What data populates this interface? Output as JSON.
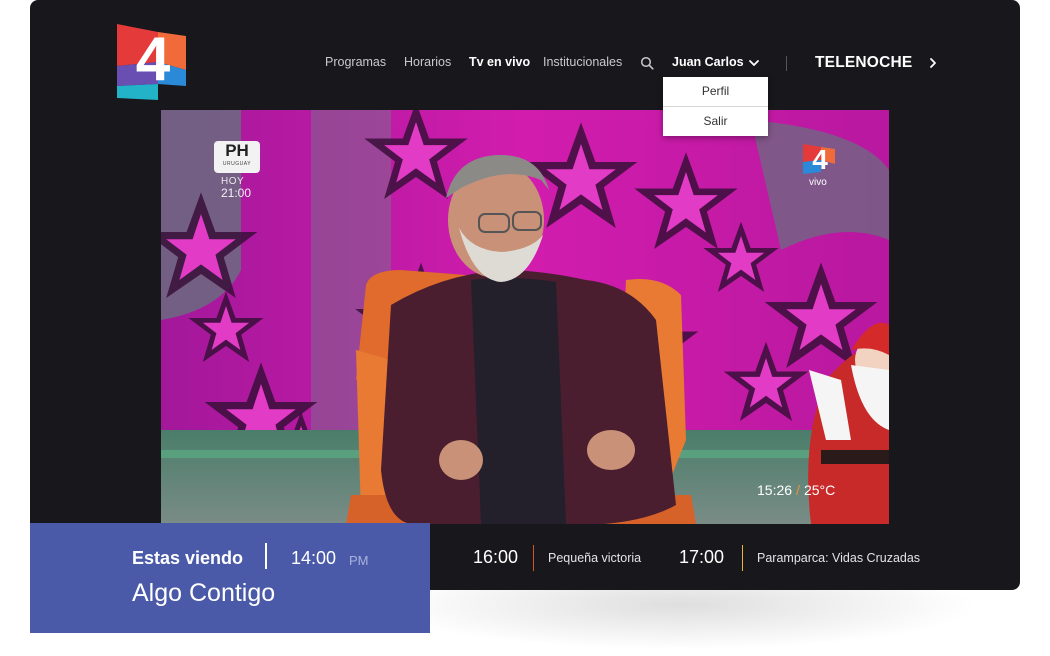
{
  "nav": {
    "items": [
      {
        "label": "Programas"
      },
      {
        "label": "Horarios"
      },
      {
        "label": "Tv en vivo"
      },
      {
        "label": "Institucionales"
      }
    ],
    "search_icon": "search-icon",
    "user_name": "Juan Carlos",
    "partner_brand": "TELENOCHE"
  },
  "dropdown": {
    "items": [
      {
        "label": "Perfil"
      },
      {
        "label": "Salir"
      }
    ]
  },
  "video": {
    "channel_badge": "PH",
    "channel_badge_sub": "URUGUAY",
    "channel_day": "HOY",
    "channel_time": "21:00",
    "live_label": "vivo",
    "clock": "15:26",
    "temperature": "25°C"
  },
  "schedule": {
    "items": [
      {
        "time": "16:00",
        "title": "Pequeña victoria",
        "accent": "#d3542a"
      },
      {
        "time": "17:00",
        "title": "Paramparca: Vidas Cruzadas",
        "accent": "#e8b53a"
      }
    ]
  },
  "now": {
    "label": "Estas viendo",
    "time": "14:00",
    "ampm": "PM",
    "title": "Algo Contigo"
  },
  "colors": {
    "frame_bg": "#18181c",
    "now_panel_bg": "#4a5aa8",
    "video_magenta": "#c21ba6"
  }
}
